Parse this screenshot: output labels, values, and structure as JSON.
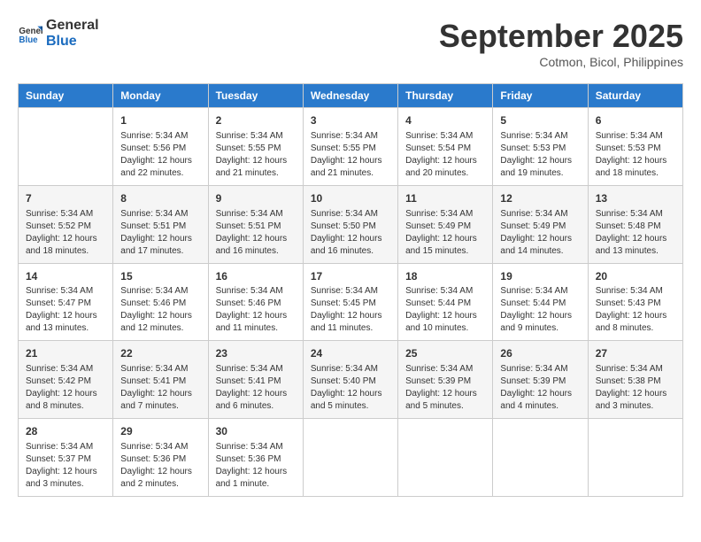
{
  "header": {
    "logo_line1": "General",
    "logo_line2": "Blue",
    "month": "September 2025",
    "location": "Cotmon, Bicol, Philippines"
  },
  "days_of_week": [
    "Sunday",
    "Monday",
    "Tuesday",
    "Wednesday",
    "Thursday",
    "Friday",
    "Saturday"
  ],
  "weeks": [
    [
      {
        "day": "",
        "info": ""
      },
      {
        "day": "1",
        "info": "Sunrise: 5:34 AM\nSunset: 5:56 PM\nDaylight: 12 hours\nand 22 minutes."
      },
      {
        "day": "2",
        "info": "Sunrise: 5:34 AM\nSunset: 5:55 PM\nDaylight: 12 hours\nand 21 minutes."
      },
      {
        "day": "3",
        "info": "Sunrise: 5:34 AM\nSunset: 5:55 PM\nDaylight: 12 hours\nand 21 minutes."
      },
      {
        "day": "4",
        "info": "Sunrise: 5:34 AM\nSunset: 5:54 PM\nDaylight: 12 hours\nand 20 minutes."
      },
      {
        "day": "5",
        "info": "Sunrise: 5:34 AM\nSunset: 5:53 PM\nDaylight: 12 hours\nand 19 minutes."
      },
      {
        "day": "6",
        "info": "Sunrise: 5:34 AM\nSunset: 5:53 PM\nDaylight: 12 hours\nand 18 minutes."
      }
    ],
    [
      {
        "day": "7",
        "info": "Sunrise: 5:34 AM\nSunset: 5:52 PM\nDaylight: 12 hours\nand 18 minutes."
      },
      {
        "day": "8",
        "info": "Sunrise: 5:34 AM\nSunset: 5:51 PM\nDaylight: 12 hours\nand 17 minutes."
      },
      {
        "day": "9",
        "info": "Sunrise: 5:34 AM\nSunset: 5:51 PM\nDaylight: 12 hours\nand 16 minutes."
      },
      {
        "day": "10",
        "info": "Sunrise: 5:34 AM\nSunset: 5:50 PM\nDaylight: 12 hours\nand 16 minutes."
      },
      {
        "day": "11",
        "info": "Sunrise: 5:34 AM\nSunset: 5:49 PM\nDaylight: 12 hours\nand 15 minutes."
      },
      {
        "day": "12",
        "info": "Sunrise: 5:34 AM\nSunset: 5:49 PM\nDaylight: 12 hours\nand 14 minutes."
      },
      {
        "day": "13",
        "info": "Sunrise: 5:34 AM\nSunset: 5:48 PM\nDaylight: 12 hours\nand 13 minutes."
      }
    ],
    [
      {
        "day": "14",
        "info": "Sunrise: 5:34 AM\nSunset: 5:47 PM\nDaylight: 12 hours\nand 13 minutes."
      },
      {
        "day": "15",
        "info": "Sunrise: 5:34 AM\nSunset: 5:46 PM\nDaylight: 12 hours\nand 12 minutes."
      },
      {
        "day": "16",
        "info": "Sunrise: 5:34 AM\nSunset: 5:46 PM\nDaylight: 12 hours\nand 11 minutes."
      },
      {
        "day": "17",
        "info": "Sunrise: 5:34 AM\nSunset: 5:45 PM\nDaylight: 12 hours\nand 11 minutes."
      },
      {
        "day": "18",
        "info": "Sunrise: 5:34 AM\nSunset: 5:44 PM\nDaylight: 12 hours\nand 10 minutes."
      },
      {
        "day": "19",
        "info": "Sunrise: 5:34 AM\nSunset: 5:44 PM\nDaylight: 12 hours\nand 9 minutes."
      },
      {
        "day": "20",
        "info": "Sunrise: 5:34 AM\nSunset: 5:43 PM\nDaylight: 12 hours\nand 8 minutes."
      }
    ],
    [
      {
        "day": "21",
        "info": "Sunrise: 5:34 AM\nSunset: 5:42 PM\nDaylight: 12 hours\nand 8 minutes."
      },
      {
        "day": "22",
        "info": "Sunrise: 5:34 AM\nSunset: 5:41 PM\nDaylight: 12 hours\nand 7 minutes."
      },
      {
        "day": "23",
        "info": "Sunrise: 5:34 AM\nSunset: 5:41 PM\nDaylight: 12 hours\nand 6 minutes."
      },
      {
        "day": "24",
        "info": "Sunrise: 5:34 AM\nSunset: 5:40 PM\nDaylight: 12 hours\nand 5 minutes."
      },
      {
        "day": "25",
        "info": "Sunrise: 5:34 AM\nSunset: 5:39 PM\nDaylight: 12 hours\nand 5 minutes."
      },
      {
        "day": "26",
        "info": "Sunrise: 5:34 AM\nSunset: 5:39 PM\nDaylight: 12 hours\nand 4 minutes."
      },
      {
        "day": "27",
        "info": "Sunrise: 5:34 AM\nSunset: 5:38 PM\nDaylight: 12 hours\nand 3 minutes."
      }
    ],
    [
      {
        "day": "28",
        "info": "Sunrise: 5:34 AM\nSunset: 5:37 PM\nDaylight: 12 hours\nand 3 minutes."
      },
      {
        "day": "29",
        "info": "Sunrise: 5:34 AM\nSunset: 5:36 PM\nDaylight: 12 hours\nand 2 minutes."
      },
      {
        "day": "30",
        "info": "Sunrise: 5:34 AM\nSunset: 5:36 PM\nDaylight: 12 hours\nand 1 minute."
      },
      {
        "day": "",
        "info": ""
      },
      {
        "day": "",
        "info": ""
      },
      {
        "day": "",
        "info": ""
      },
      {
        "day": "",
        "info": ""
      }
    ]
  ]
}
